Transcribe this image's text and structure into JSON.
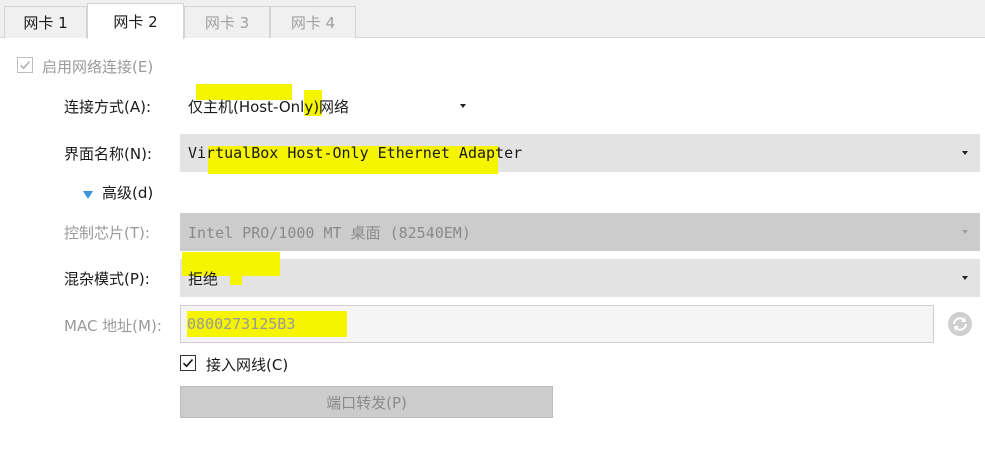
{
  "tabs": [
    {
      "label": "网卡 1",
      "state": "normal"
    },
    {
      "label": "网卡 2",
      "state": "active"
    },
    {
      "label": "网卡 3",
      "state": "disabled"
    },
    {
      "label": "网卡 4",
      "state": "disabled"
    }
  ],
  "enable_network": {
    "label": "启用网络连接(E)",
    "checked": true,
    "enabled": false
  },
  "attachment": {
    "label": "连接方式(A):",
    "value": "仅主机(Host-Only)网络"
  },
  "interface_name": {
    "label": "界面名称(N):",
    "value": "VirtualBox Host-Only Ethernet Adapter"
  },
  "advanced": {
    "label": "高级(d)",
    "expanded": true
  },
  "adapter_type": {
    "label": "控制芯片(T):",
    "value": "Intel PRO/1000 MT 桌面 (82540EM)",
    "enabled": false
  },
  "promiscuous": {
    "label": "混杂模式(P):",
    "value": "拒绝"
  },
  "mac": {
    "label": "MAC 地址(M):",
    "value": "0800273125B3"
  },
  "cable_connected": {
    "label": "接入网线(C)",
    "checked": true
  },
  "port_forwarding": {
    "label": "端口转发(P)",
    "enabled": false
  },
  "colors": {
    "highlight": "#f5f500",
    "expander": "#3a96dd",
    "disabled_text": "#9a9a9a",
    "combo_bg": "#e3e3e3"
  },
  "icons": {
    "refresh_mac": "refresh-icon",
    "expander": "triangle-down-icon"
  }
}
